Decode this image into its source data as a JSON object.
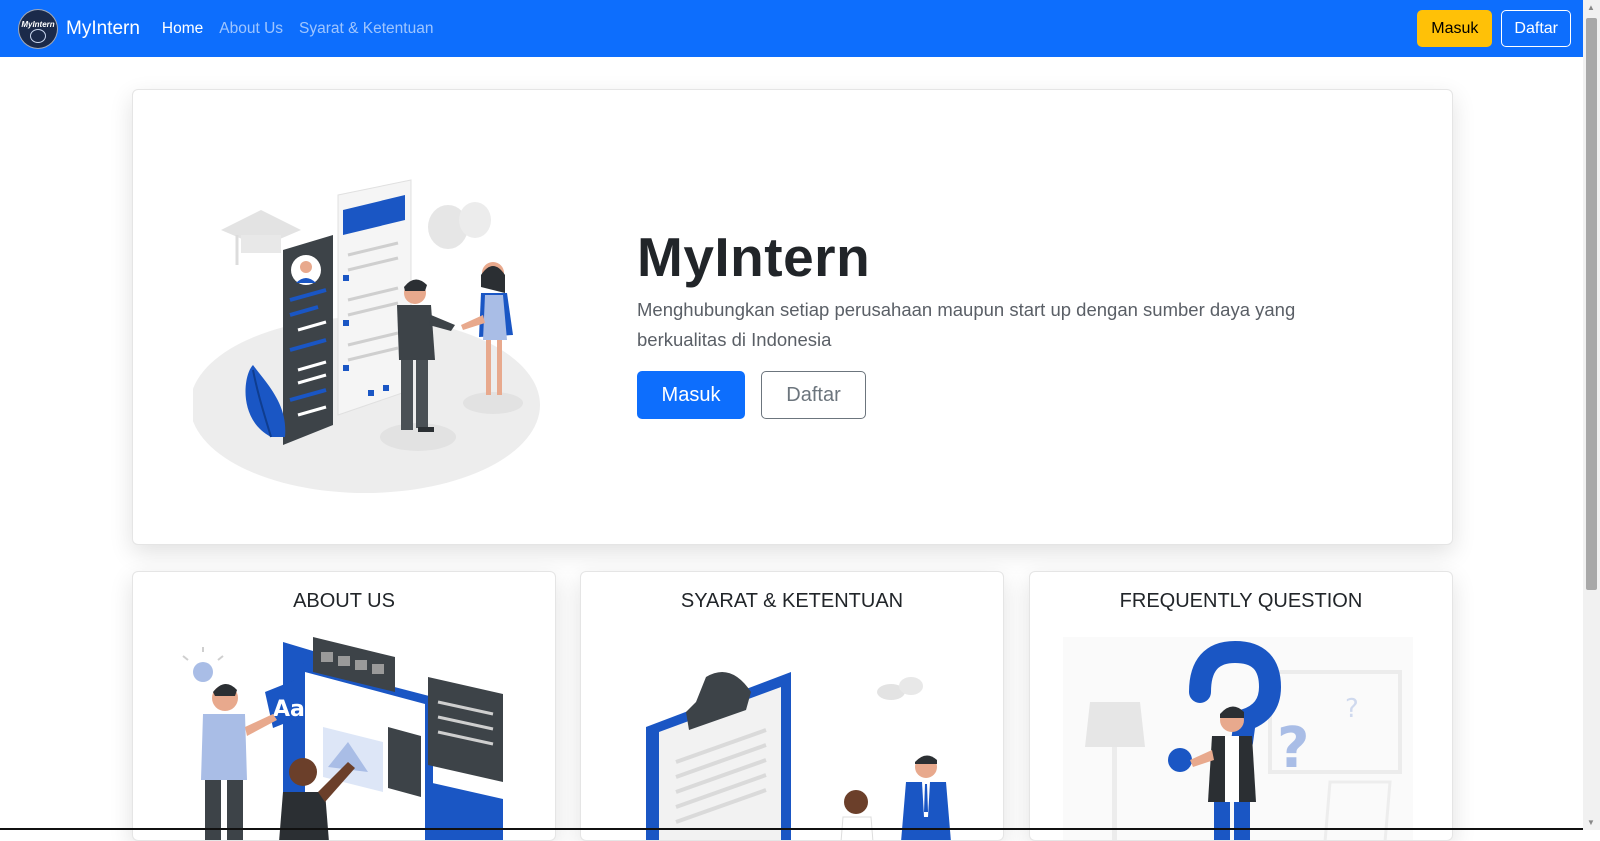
{
  "navbar": {
    "brand_name": "MyIntern",
    "logo_text": "MyIntern",
    "links": [
      {
        "label": "Home",
        "active": true
      },
      {
        "label": "About Us",
        "active": false
      },
      {
        "label": "Syarat & Ketentuan",
        "active": false
      }
    ],
    "login_label": "Masuk",
    "register_label": "Daftar"
  },
  "hero": {
    "title": "MyIntern",
    "description": "Menghubungkan setiap perusahaan maupun start up dengan sumber daya yang berkualitas di Indonesia",
    "login_label": "Masuk",
    "register_label": "Daftar"
  },
  "cards": [
    {
      "title": "ABOUT US"
    },
    {
      "title": "SYARAT & KETENTUAN"
    },
    {
      "title": "FREQUENTLY QUESTION"
    }
  ],
  "colors": {
    "primary": "#0d6efd",
    "warning": "#ffc107",
    "illustration_blue": "#1a56c4",
    "illustration_dark": "#3d4348"
  }
}
